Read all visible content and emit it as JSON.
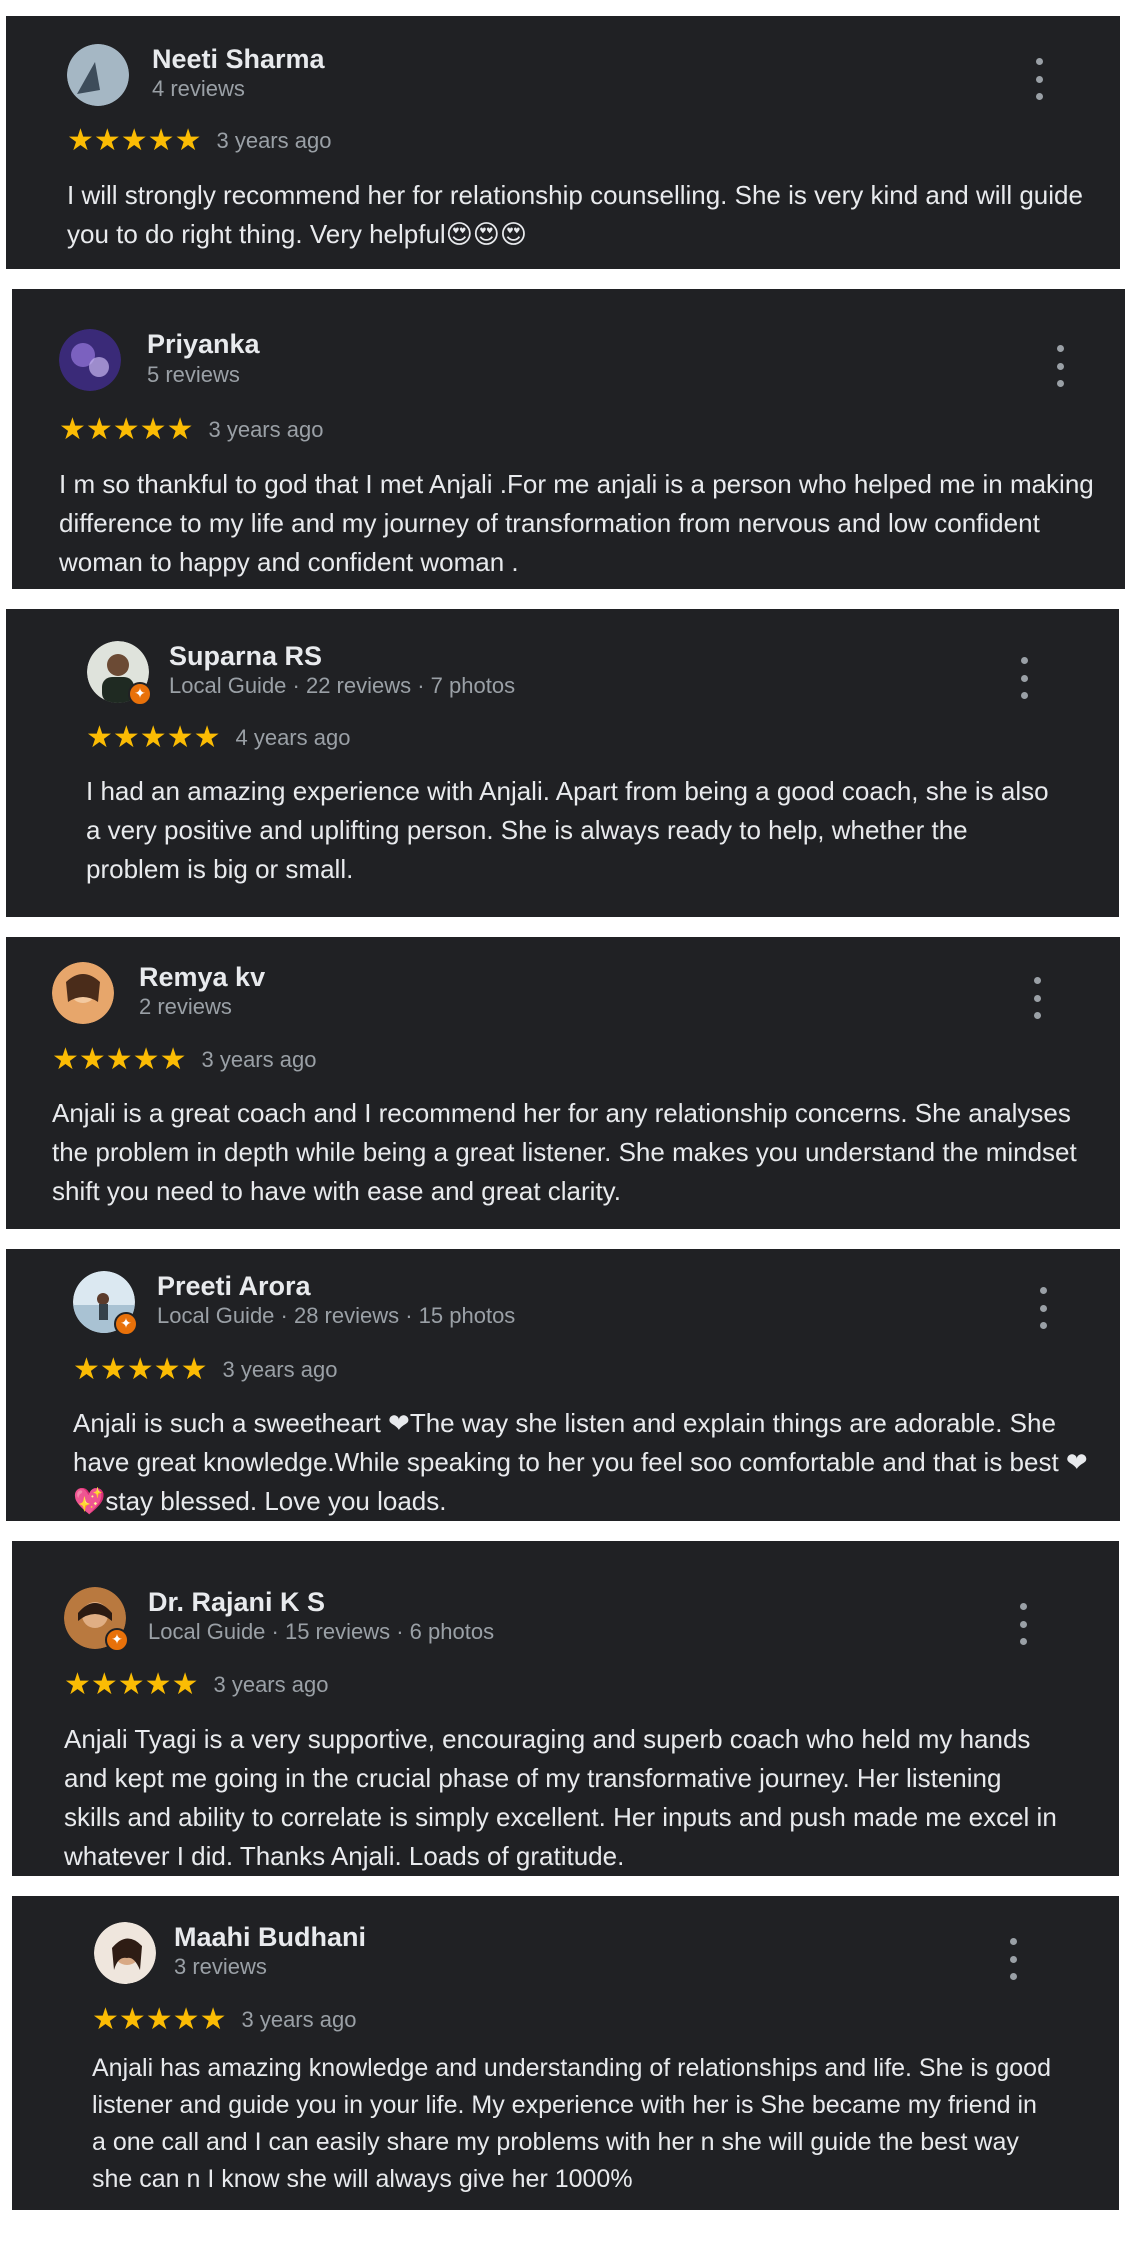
{
  "reviews": [
    {
      "name": "Neeti Sharma",
      "meta": "4 reviews",
      "stars": "★★★★★",
      "time": "3 years ago",
      "text": "I will strongly recommend her for relationship counselling. She is very kind and will guide you to do right thing. Very helpful😍😍😍",
      "avatar_color": "#8ea3b5",
      "local_guide": false
    },
    {
      "name": "Priyanka",
      "meta": "5 reviews",
      "stars": "★★★★★",
      "time": "3 years ago",
      "text": "I m so thankful to god that I met Anjali .For me anjali is a person who helped me in making difference to my life and my journey of transformation from nervous and low confident woman to happy and confident woman .",
      "avatar_color": "#5b3f9a",
      "local_guide": false
    },
    {
      "name": "Suparna RS",
      "meta": "Local Guide · 22 reviews · 7 photos",
      "stars": "★★★★★",
      "time": "4 years ago",
      "text": "I had an amazing experience with Anjali. Apart from being a good coach, she is also a very positive and uplifting person. She is always ready to help, whether the problem is big or small.",
      "avatar_color": "#3c4a3e",
      "local_guide": true
    },
    {
      "name": "Remya kv",
      "meta": "2 reviews",
      "stars": "★★★★★",
      "time": "3 years ago",
      "text": "Anjali is a great coach and I recommend her for any relationship concerns. She analyses the problem in depth while being a great listener. She makes you understand the mindset shift you need to have with ease and great clarity.",
      "avatar_color": "#c98a55",
      "local_guide": false
    },
    {
      "name": "Preeti Arora",
      "meta": "Local Guide · 28 reviews · 15 photos",
      "stars": "★★★★★",
      "time": "3 years ago",
      "text": "Anjali is such a sweetheart ❤The way she listen and explain things are adorable. She have great knowledge.While speaking to her you feel soo comfortable and that is best ❤💖stay blessed. Love you loads.",
      "avatar_color": "#bfd6e6",
      "local_guide": true
    },
    {
      "name": "Dr. Rajani K S",
      "meta": "Local Guide · 15 reviews · 6 photos",
      "stars": "★★★★★",
      "time": "3 years ago",
      "text": "Anjali Tyagi is a very supportive, encouraging and superb coach who held my hands and kept me going in the crucial phase of my transformative journey. Her listening skills and ability to correlate is simply excellent. Her inputs and push made me excel in whatever I did. Thanks Anjali. Loads of gratitude.",
      "avatar_color": "#a86a3a",
      "local_guide": true
    },
    {
      "name": "Maahi Budhani",
      "meta": "3 reviews",
      "stars": "★★★★★",
      "time": "3 years ago",
      "text": "Anjali has amazing knowledge and understanding of relationships and life. She is good listener and guide you in your life. My experience with her is She became my friend in a one call and I can easily share my problems with her n she will guide the best way she can n I know she will always give her 1000%",
      "avatar_color": "#d9c4b3",
      "local_guide": false
    }
  ]
}
